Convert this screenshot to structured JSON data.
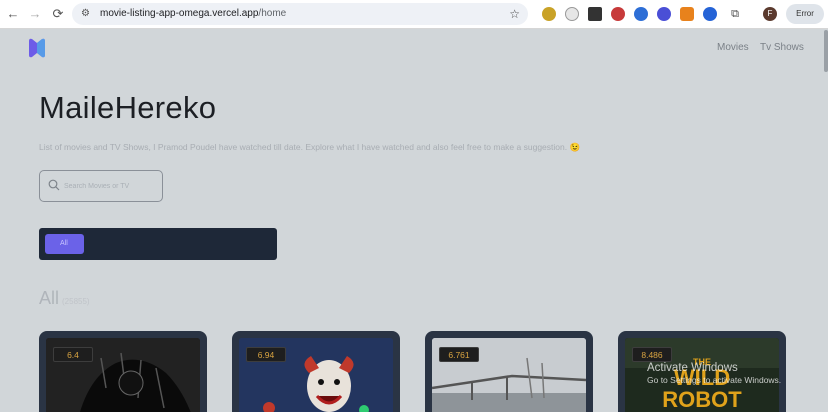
{
  "browser": {
    "back_icon": "←",
    "forward_icon": "→",
    "reload_icon": "⟳",
    "url_host": "movie-listing-app-omega.vercel.app",
    "url_path": "/home",
    "bookmark_icon": "☆",
    "profile_initial": "F",
    "error_label": "Error"
  },
  "nav": {
    "movies": "Movies",
    "tv_shows": "Tv Shows"
  },
  "hero": {
    "title": "MaileHereko",
    "subtitle": "List of movies and TV Shows, I Pramod Poudel have watched till date. Explore what I have watched and also feel free to make a suggestion. 😉"
  },
  "search": {
    "placeholder": "Search Movies or TV"
  },
  "filter": {
    "all_label": "All"
  },
  "section": {
    "title": "All",
    "count_label": "(25855)"
  },
  "cards": [
    {
      "rating": "6.4"
    },
    {
      "rating": "6.94"
    },
    {
      "rating": "6.761"
    },
    {
      "rating": "8.486",
      "poster_text": "THE WILD ROBOT"
    }
  ],
  "watermark": {
    "line1": "Activate Windows",
    "line2": "Go to Settings to activate Windows."
  },
  "colors": {
    "page_bg": "#d1d6d9",
    "accent": "#6b62e8",
    "card_bg": "#2a3444",
    "filter_bg": "#1e2838",
    "rating_text": "#d9a441"
  }
}
